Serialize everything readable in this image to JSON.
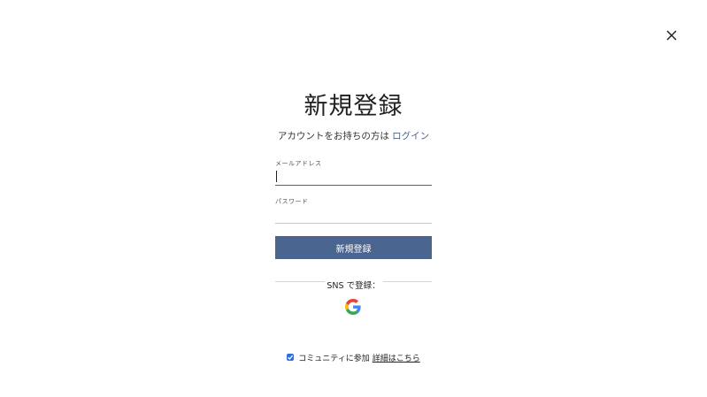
{
  "dialog": {
    "close_icon": "close-icon"
  },
  "header": {
    "title": "新規登録",
    "login_prompt": "アカウントをお持ちの方は",
    "login_link": "ログイン"
  },
  "form": {
    "email": {
      "label": "メールアドレス",
      "value": "",
      "placeholder": ""
    },
    "password": {
      "label": "パスワード",
      "value": "",
      "placeholder": ""
    },
    "submit_label": "新規登録"
  },
  "sns": {
    "label": "SNS で登録：",
    "providers": [
      "google-icon"
    ]
  },
  "community": {
    "checked": true,
    "label": "コミュニティに参加",
    "details_link": "詳細はこちら"
  },
  "colors": {
    "accent": "#4a6590",
    "checkbox": "#2d6fe0"
  }
}
